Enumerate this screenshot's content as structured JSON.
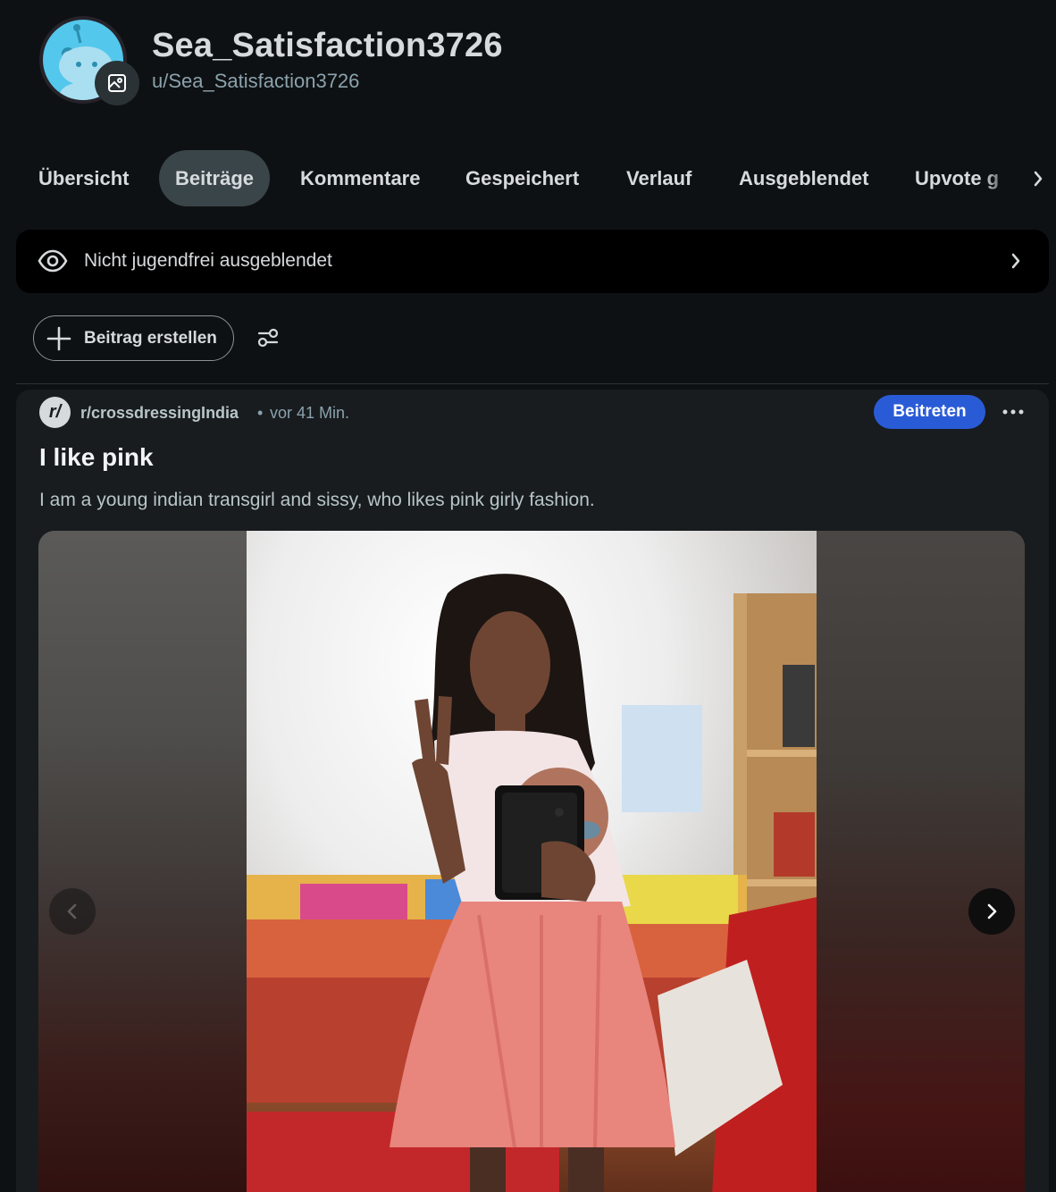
{
  "profile": {
    "display_name": "Sea_Satisfaction3726",
    "username": "u/Sea_Satisfaction3726",
    "avatar_icon": "snoo-avatar",
    "edit_icon": "image-edit-icon"
  },
  "tabs": [
    {
      "label": "Übersicht",
      "active": false
    },
    {
      "label": "Beiträge",
      "active": true
    },
    {
      "label": "Kommentare",
      "active": false
    },
    {
      "label": "Gespeichert",
      "active": false
    },
    {
      "label": "Verlauf",
      "active": false
    },
    {
      "label": "Ausgeblendet",
      "active": false
    },
    {
      "label": "Upvote g",
      "active": false
    }
  ],
  "nsfw_bar": {
    "label": "Nicht jugendfrei ausgeblendet"
  },
  "actions": {
    "create_post": "Beitrag erstellen"
  },
  "post": {
    "subreddit_icon": "r/",
    "subreddit": "r/crossdressingIndia",
    "separator": "•",
    "time": "vor 41 Min.",
    "join_label": "Beitreten",
    "title": "I like pink",
    "body": "I am a young indian transgirl and sissy, who likes pink girly fashion."
  },
  "colors": {
    "background": "#0e1113",
    "card": "#181c1f",
    "active_tab": "#3a4549",
    "join_button": "#2a5bd7",
    "text": "#d7dadc",
    "muted": "#8ba2ad"
  }
}
